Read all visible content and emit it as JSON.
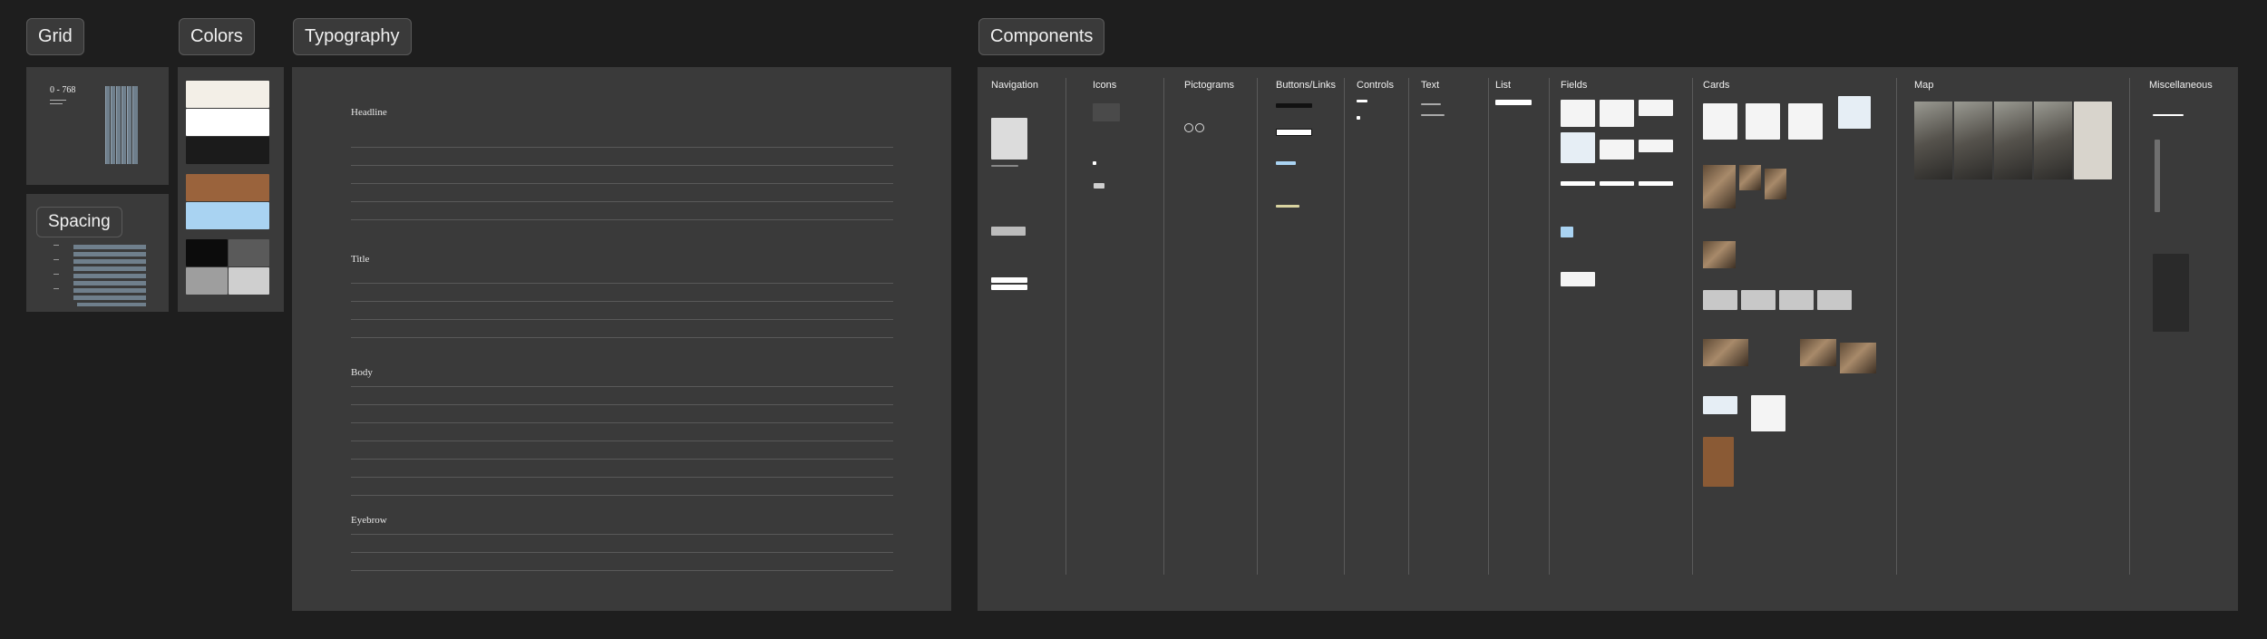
{
  "sections": {
    "grid": "Grid",
    "colors": "Colors",
    "typography": "Typography",
    "components": "Components",
    "spacing": "Spacing"
  },
  "grid_card": {
    "range": "0 - 768"
  },
  "typography": {
    "groups": [
      "Headline",
      "Title",
      "Body",
      "Eyebrow"
    ]
  },
  "components": {
    "columns": [
      "Navigation",
      "Icons",
      "Pictograms",
      "Buttons/Links",
      "Controls",
      "Text",
      "List",
      "Fields",
      "Cards",
      "Map",
      "Miscellaneous"
    ]
  }
}
